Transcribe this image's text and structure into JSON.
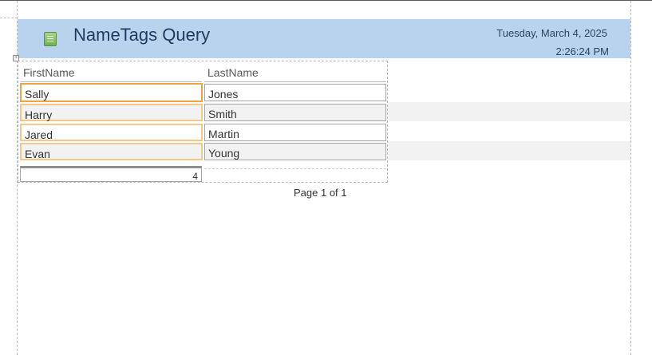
{
  "report": {
    "title": "NameTags Query",
    "date": "Tuesday, March 4, 2025",
    "time": "2:26:24 PM"
  },
  "columns": {
    "first": "FirstName",
    "last": "LastName"
  },
  "rows": [
    {
      "first": "Sally",
      "last": "Jones"
    },
    {
      "first": "Harry",
      "last": "Smith"
    },
    {
      "first": "Jared",
      "last": "Martin"
    },
    {
      "first": "Evan",
      "last": "Young"
    }
  ],
  "record_count": "4",
  "page_footer": "Page 1 of 1",
  "colors": {
    "header_band": "#b9d3ef",
    "selected_border": "#f0a33f",
    "alt_row": "#f2f2f2"
  }
}
